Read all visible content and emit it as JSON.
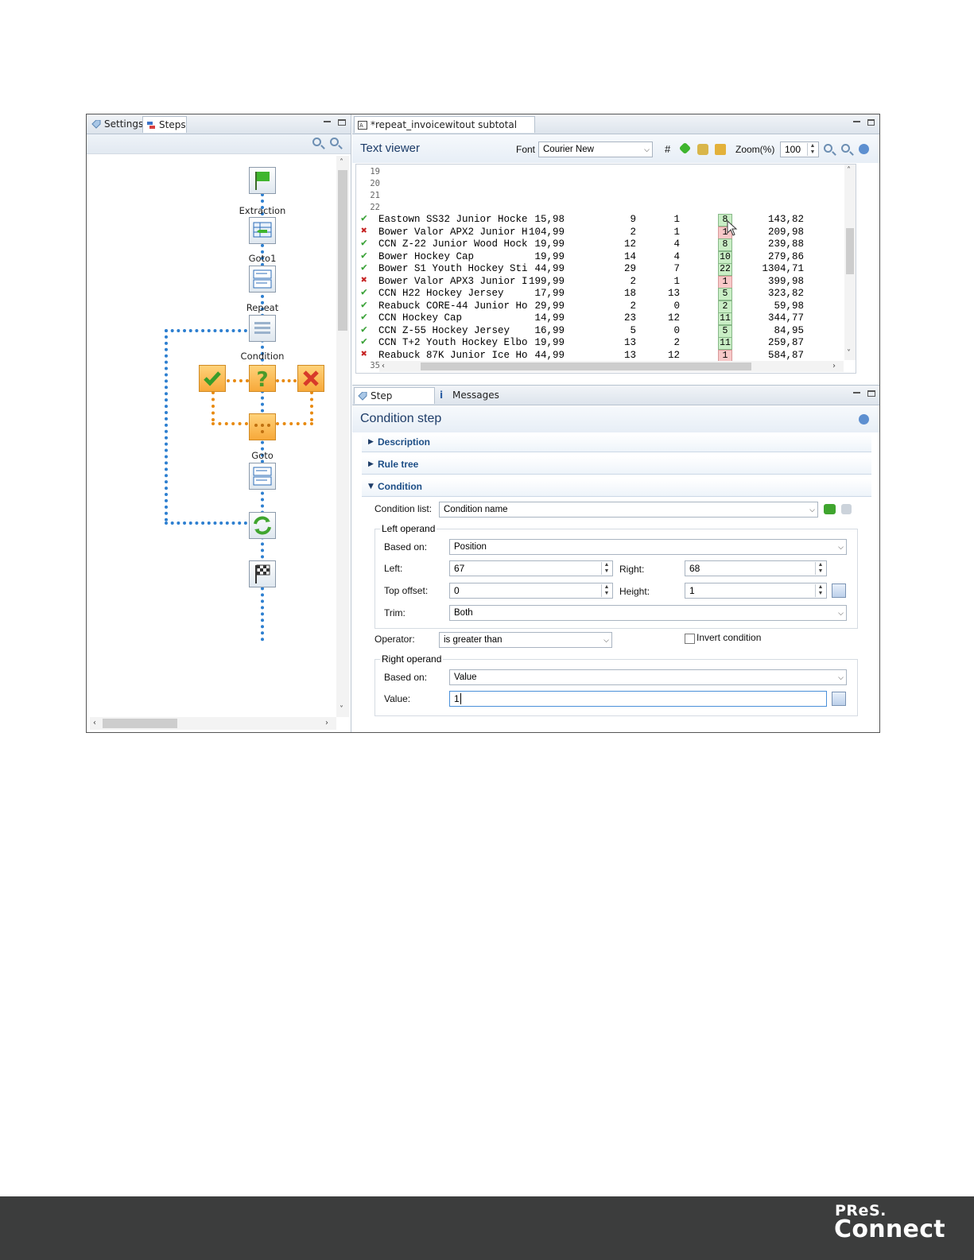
{
  "left_panel": {
    "tabs": [
      {
        "label": "Settings"
      },
      {
        "label": "Steps"
      }
    ],
    "steps": [
      {
        "label": "",
        "icon": "start-flag-icon"
      },
      {
        "label": "Extraction",
        "icon": "extraction-table-icon"
      },
      {
        "label": "Goto1",
        "icon": "goto-icon"
      },
      {
        "label": "Repeat",
        "icon": "repeat-icon"
      },
      {
        "label": "Condition",
        "icon": "condition-question-icon"
      },
      {
        "label": "Goto",
        "icon": "goto-icon"
      },
      {
        "label": "",
        "icon": "loop-arrows-icon"
      },
      {
        "label": "",
        "icon": "finish-flag-icon"
      }
    ]
  },
  "editor": {
    "tab_title": "*repeat_invoicewitout subtotal (TXT)",
    "viewer_title": "Text viewer",
    "font_label": "Font",
    "font_value": "Courier New",
    "hash_label": "#",
    "zoom_label": "Zoom(%)",
    "zoom_value": "100",
    "line_numbers_top": [
      "19",
      "20",
      "21",
      "22"
    ],
    "line_number_bottom": "35",
    "rows": [
      {
        "status": "ok",
        "desc": "Eastown SS32 Junior Hocke",
        "price": "15,98",
        "ordered": "9",
        "backorder": "1",
        "shipped": "8",
        "total": "143,82"
      },
      {
        "status": "bad",
        "desc": "Bower Valor APX2 Junior H",
        "price": "104,99",
        "ordered": "2",
        "backorder": "1",
        "shipped": "1",
        "total": "209,98"
      },
      {
        "status": "ok",
        "desc": "CCN Z-22 Junior Wood Hock",
        "price": "19,99",
        "ordered": "12",
        "backorder": "4",
        "shipped": "8",
        "total": "239,88"
      },
      {
        "status": "ok",
        "desc": "Bower Hockey Cap",
        "price": "19,99",
        "ordered": "14",
        "backorder": "4",
        "shipped": "10",
        "total": "279,86"
      },
      {
        "status": "ok",
        "desc": "Bower S1 Youth Hockey Sti",
        "price": "44,99",
        "ordered": "29",
        "backorder": "7",
        "shipped": "22",
        "total": "1304,71"
      },
      {
        "status": "bad",
        "desc": "Bower Valor APX3 Junior I",
        "price": "199,99",
        "ordered": "2",
        "backorder": "1",
        "shipped": "1",
        "total": "399,98"
      },
      {
        "status": "ok",
        "desc": "CCN H22 Hockey Jersey",
        "price": "17,99",
        "ordered": "18",
        "backorder": "13",
        "shipped": "5",
        "total": "323,82"
      },
      {
        "status": "ok",
        "desc": "Reabuck CORE-44 Junior Ho",
        "price": "29,99",
        "ordered": "2",
        "backorder": "0",
        "shipped": "2",
        "total": "59,98"
      },
      {
        "status": "ok",
        "desc": "CCN Hockey Cap",
        "price": "14,99",
        "ordered": "23",
        "backorder": "12",
        "shipped": "11",
        "total": "344,77"
      },
      {
        "status": "ok",
        "desc": "CCN Z-55 Hockey Jersey",
        "price": "16,99",
        "ordered": "5",
        "backorder": "0",
        "shipped": "5",
        "total": "84,95"
      },
      {
        "status": "ok",
        "desc": "CCN T+2 Youth Hockey Elbo",
        "price": "19,99",
        "ordered": "13",
        "backorder": "2",
        "shipped": "11",
        "total": "259,87"
      },
      {
        "status": "bad",
        "desc": "Reabuck 87K Junior Ice Ho",
        "price": "44,99",
        "ordered": "13",
        "backorder": "12",
        "shipped": "1",
        "total": "584,87"
      }
    ]
  },
  "props": {
    "tabs": [
      {
        "label": "Step Properties"
      },
      {
        "label": "Messages"
      }
    ],
    "title": "Condition step",
    "sections": [
      {
        "label": "Description"
      },
      {
        "label": "Rule tree"
      },
      {
        "label": "Condition"
      }
    ],
    "condition_list_label": "Condition list:",
    "condition_list_value": "Condition name",
    "left_operand": {
      "title": "Left operand",
      "based_on_label": "Based on:",
      "based_on_value": "Position",
      "left_label": "Left:",
      "left_value": "67",
      "right_label": "Right:",
      "right_value": "68",
      "top_offset_label": "Top offset:",
      "top_offset_value": "0",
      "height_label": "Height:",
      "height_value": "1",
      "trim_label": "Trim:",
      "trim_value": "Both"
    },
    "operator_label": "Operator:",
    "operator_value": "is greater than",
    "invert_label": "Invert condition",
    "invert_checked": false,
    "right_operand": {
      "title": "Right operand",
      "based_on_label": "Based on:",
      "based_on_value": "Value",
      "value_label": "Value:",
      "value_value": "1"
    }
  },
  "footer": {
    "logo_top": "PReS.",
    "logo_bottom": "Connect"
  }
}
